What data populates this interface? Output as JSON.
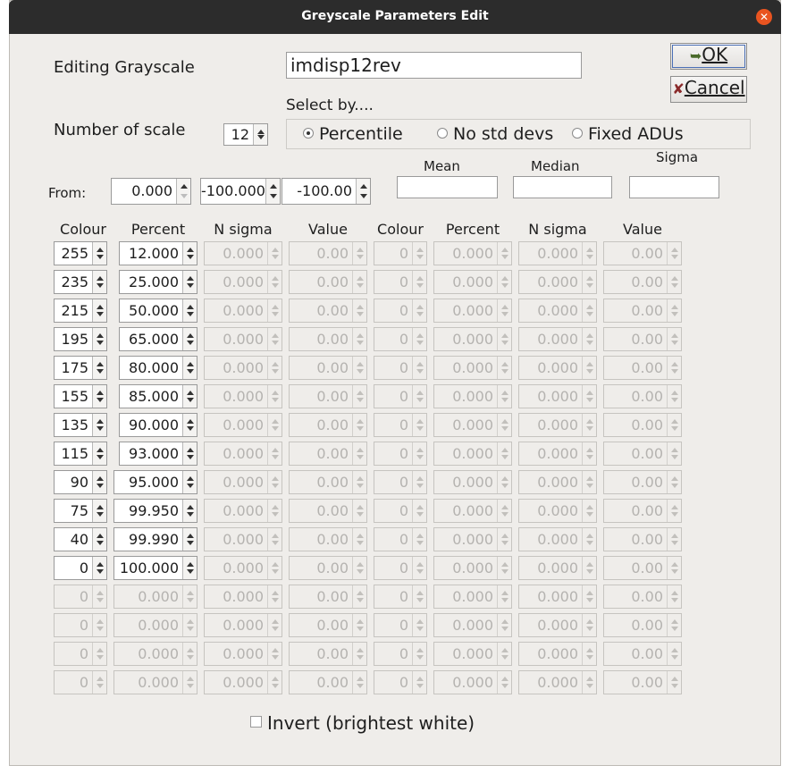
{
  "window": {
    "title": "Greyscale Parameters Edit"
  },
  "editing_label": "Editing Grayscale",
  "grayscale_name": "imdisp12rev",
  "ok_label": "OK",
  "cancel_label": "Cancel",
  "select_by_label": "Select by....",
  "number_of_scales_label": "Number of scale",
  "number_of_scales_value": "12",
  "radio": {
    "percentile": "Percentile",
    "nostd": "No std devs",
    "fixed": "Fixed ADUs",
    "selected": "Percentile"
  },
  "stats": {
    "mean_label": "Mean",
    "median_label": "Median",
    "sigma_label": "Sigma",
    "mean": "",
    "median": "",
    "sigma": ""
  },
  "from": {
    "label": "From:",
    "v1": "0.000",
    "v2": "-100.000",
    "v3": "-100.00"
  },
  "headers": [
    "Colour",
    "Percent",
    "N sigma",
    "Value",
    "Colour",
    "Percent",
    "N sigma",
    "Value"
  ],
  "rows": [
    [
      "255",
      "12.000",
      "0.000",
      "0.00",
      "0",
      "0.000",
      "0.000",
      "0.00"
    ],
    [
      "235",
      "25.000",
      "0.000",
      "0.00",
      "0",
      "0.000",
      "0.000",
      "0.00"
    ],
    [
      "215",
      "50.000",
      "0.000",
      "0.00",
      "0",
      "0.000",
      "0.000",
      "0.00"
    ],
    [
      "195",
      "65.000",
      "0.000",
      "0.00",
      "0",
      "0.000",
      "0.000",
      "0.00"
    ],
    [
      "175",
      "80.000",
      "0.000",
      "0.00",
      "0",
      "0.000",
      "0.000",
      "0.00"
    ],
    [
      "155",
      "85.000",
      "0.000",
      "0.00",
      "0",
      "0.000",
      "0.000",
      "0.00"
    ],
    [
      "135",
      "90.000",
      "0.000",
      "0.00",
      "0",
      "0.000",
      "0.000",
      "0.00"
    ],
    [
      "115",
      "93.000",
      "0.000",
      "0.00",
      "0",
      "0.000",
      "0.000",
      "0.00"
    ],
    [
      "90",
      "95.000",
      "0.000",
      "0.00",
      "0",
      "0.000",
      "0.000",
      "0.00"
    ],
    [
      "75",
      "99.950",
      "0.000",
      "0.00",
      "0",
      "0.000",
      "0.000",
      "0.00"
    ],
    [
      "40",
      "99.990",
      "0.000",
      "0.00",
      "0",
      "0.000",
      "0.000",
      "0.00"
    ],
    [
      "0",
      "100.000",
      "0.000",
      "0.00",
      "0",
      "0.000",
      "0.000",
      "0.00"
    ],
    [
      "0",
      "0.000",
      "0.000",
      "0.00",
      "0",
      "0.000",
      "0.000",
      "0.00"
    ],
    [
      "0",
      "0.000",
      "0.000",
      "0.00",
      "0",
      "0.000",
      "0.000",
      "0.00"
    ],
    [
      "0",
      "0.000",
      "0.000",
      "0.00",
      "0",
      "0.000",
      "0.000",
      "0.00"
    ],
    [
      "0",
      "0.000",
      "0.000",
      "0.00",
      "0",
      "0.000",
      "0.000",
      "0.00"
    ]
  ],
  "active_rows": 12,
  "invert_label": "Invert (brightest white)",
  "invert_checked": false
}
